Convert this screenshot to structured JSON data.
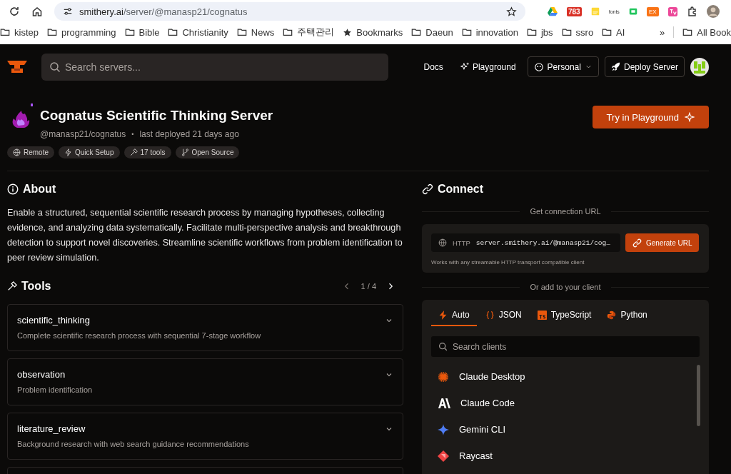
{
  "browser": {
    "url_host": "smithery.ai",
    "url_path": "/server/@manasp21/cognatus",
    "extensions": [
      {
        "kind": "drive"
      },
      {
        "kind": "badge",
        "text": "783"
      },
      {
        "kind": "note"
      },
      {
        "kind": "text",
        "text": "fonts"
      },
      {
        "kind": "screen"
      },
      {
        "kind": "tag",
        "text": "EX"
      },
      {
        "kind": "translate"
      },
      {
        "kind": "puzzle"
      }
    ],
    "bookmarks": [
      {
        "kind": "folder",
        "label": "kistep"
      },
      {
        "kind": "folder",
        "label": "programming"
      },
      {
        "kind": "folder",
        "label": "Bible"
      },
      {
        "kind": "folder",
        "label": "Christianity"
      },
      {
        "kind": "folder",
        "label": "News"
      },
      {
        "kind": "folder",
        "label": "주택관리"
      },
      {
        "kind": "star",
        "label": "Bookmarks"
      },
      {
        "kind": "folder",
        "label": "Daeun"
      },
      {
        "kind": "folder",
        "label": "innovation"
      },
      {
        "kind": "folder",
        "label": "jbs"
      },
      {
        "kind": "folder",
        "label": "ssro"
      },
      {
        "kind": "folder",
        "label": "AI"
      }
    ],
    "overflow": "»",
    "all_bookmarks": "All Book"
  },
  "header": {
    "search": {
      "placeholder": "Search servers..."
    },
    "nav": [
      {
        "kind": "link",
        "label": "Docs"
      },
      {
        "kind": "sparkle",
        "label": "Playground"
      },
      {
        "kind": "dropdown",
        "label": "Personal"
      },
      {
        "kind": "rocket",
        "label": "Deploy Server"
      }
    ]
  },
  "server": {
    "title": "Cognatus Scientific Thinking Server",
    "handle": "@manasp21/cognatus",
    "separator": "•",
    "deployed": "last deployed 21 days ago",
    "try_button": "Try in Playground",
    "tags": [
      {
        "kind": "globe",
        "label": "Remote"
      },
      {
        "kind": "bolt",
        "label": "Quick Setup"
      },
      {
        "kind": "hammer",
        "label": "17 tools"
      },
      {
        "kind": "branch",
        "label": "Open Source"
      }
    ]
  },
  "about": {
    "heading": "About",
    "text": "Enable a structured, sequential scientific research process by managing hypotheses, collecting evidence, and analyzing data systematically. Facilitate multi-perspective analysis and breakthrough detection to support novel discoveries. Streamline scientific workflows from problem identification to peer review simulation."
  },
  "tools": {
    "heading": "Tools",
    "page": "1 / 4",
    "items": [
      {
        "name": "scientific_thinking",
        "description": "Complete scientific research process with sequential 7-stage workflow",
        "expanded": false
      },
      {
        "name": "observation",
        "description": "Problem identification",
        "expanded": false
      },
      {
        "name": "literature_review",
        "description": "Background research with web search guidance recommendations",
        "expanded": false
      }
    ]
  },
  "connect": {
    "heading": "Connect",
    "url_section": "Get connection URL",
    "protocol": "HTTP",
    "url": "server.smithery.ai/@manasp21/cog…",
    "generate_button": "Generate URL",
    "note": "Works with any streamable HTTP transport compatible client",
    "client_section": "Or add to your client",
    "tabs": [
      {
        "kind": "bolt",
        "label": "Auto",
        "selected": true
      },
      {
        "kind": "braces",
        "label": "JSON",
        "selected": false
      },
      {
        "kind": "ts",
        "label": "TypeScript",
        "selected": false
      },
      {
        "kind": "python",
        "label": "Python",
        "selected": false
      }
    ],
    "client_search": {
      "placeholder": "Search clients"
    },
    "clients": [
      {
        "kind": "burst",
        "name": "Claude Desktop"
      },
      {
        "kind": "mark",
        "name": "Claude Code"
      },
      {
        "kind": "star",
        "name": "Gemini CLI"
      },
      {
        "kind": "ray",
        "name": "Raycast"
      }
    ]
  }
}
